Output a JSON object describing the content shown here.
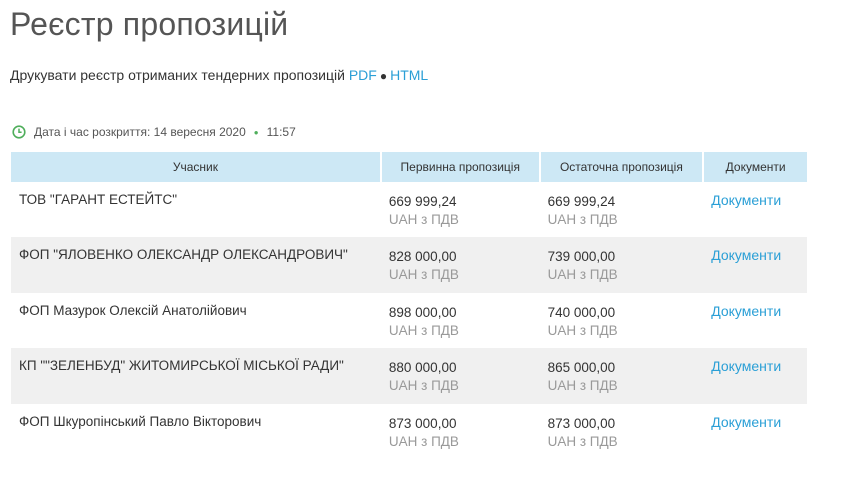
{
  "page": {
    "title": "Реєстр пропозицій",
    "print_text": "Друкувати реєстр отриманих тендерних пропозицій",
    "print_pdf": "PDF",
    "print_separator": "●",
    "print_html": "HTML"
  },
  "opening": {
    "label": "Дата і час розкриття: 14 вересня 2020",
    "separator": "●",
    "time": "11:57",
    "icon": "clock-icon",
    "icon_color": "#4fae5b"
  },
  "table": {
    "headers": [
      "Учасник",
      "Первинна пропозиція",
      "Остаточна пропозиція",
      "Документи"
    ],
    "rows": [
      {
        "participant": "ТОВ \"ГАРАНТ ЕСТЕЙТС\"",
        "initial": "669 999,24",
        "initial_cur": "UAH з ПДВ",
        "final": "669 999,24",
        "final_cur": "UAH з ПДВ",
        "docs": "Документи"
      },
      {
        "participant": "ФОП \"ЯЛОВЕНКО ОЛЕКСАНДР ОЛЕКСАНДРОВИЧ\"",
        "initial": "828 000,00",
        "initial_cur": "UAH з ПДВ",
        "final": "739 000,00",
        "final_cur": "UAH з ПДВ",
        "docs": "Документи"
      },
      {
        "participant": "ФОП Мазурок Олексій Анатолійович",
        "initial": "898 000,00",
        "initial_cur": "UAH з ПДВ",
        "final": "740 000,00",
        "final_cur": "UAH з ПДВ",
        "docs": "Документи"
      },
      {
        "participant": "КП \"\"ЗЕЛЕНБУД\" ЖИТОМИРСЬКОЇ МІСЬКОЇ РАДИ\"",
        "initial": "880 000,00",
        "initial_cur": "UAH з ПДВ",
        "final": "865 000,00",
        "final_cur": "UAH з ПДВ",
        "docs": "Документи"
      },
      {
        "participant": "ФОП Шкуропінський Павло Вікторович",
        "initial": "873 000,00",
        "initial_cur": "UAH з ПДВ",
        "final": "873 000,00",
        "final_cur": "UAH з ПДВ",
        "docs": "Документи"
      }
    ]
  },
  "colors": {
    "link": "#2a9fd6",
    "header_bg": "#cde8f5",
    "alt_row_bg": "#f0f0f0",
    "accent_green": "#4fae5b"
  }
}
